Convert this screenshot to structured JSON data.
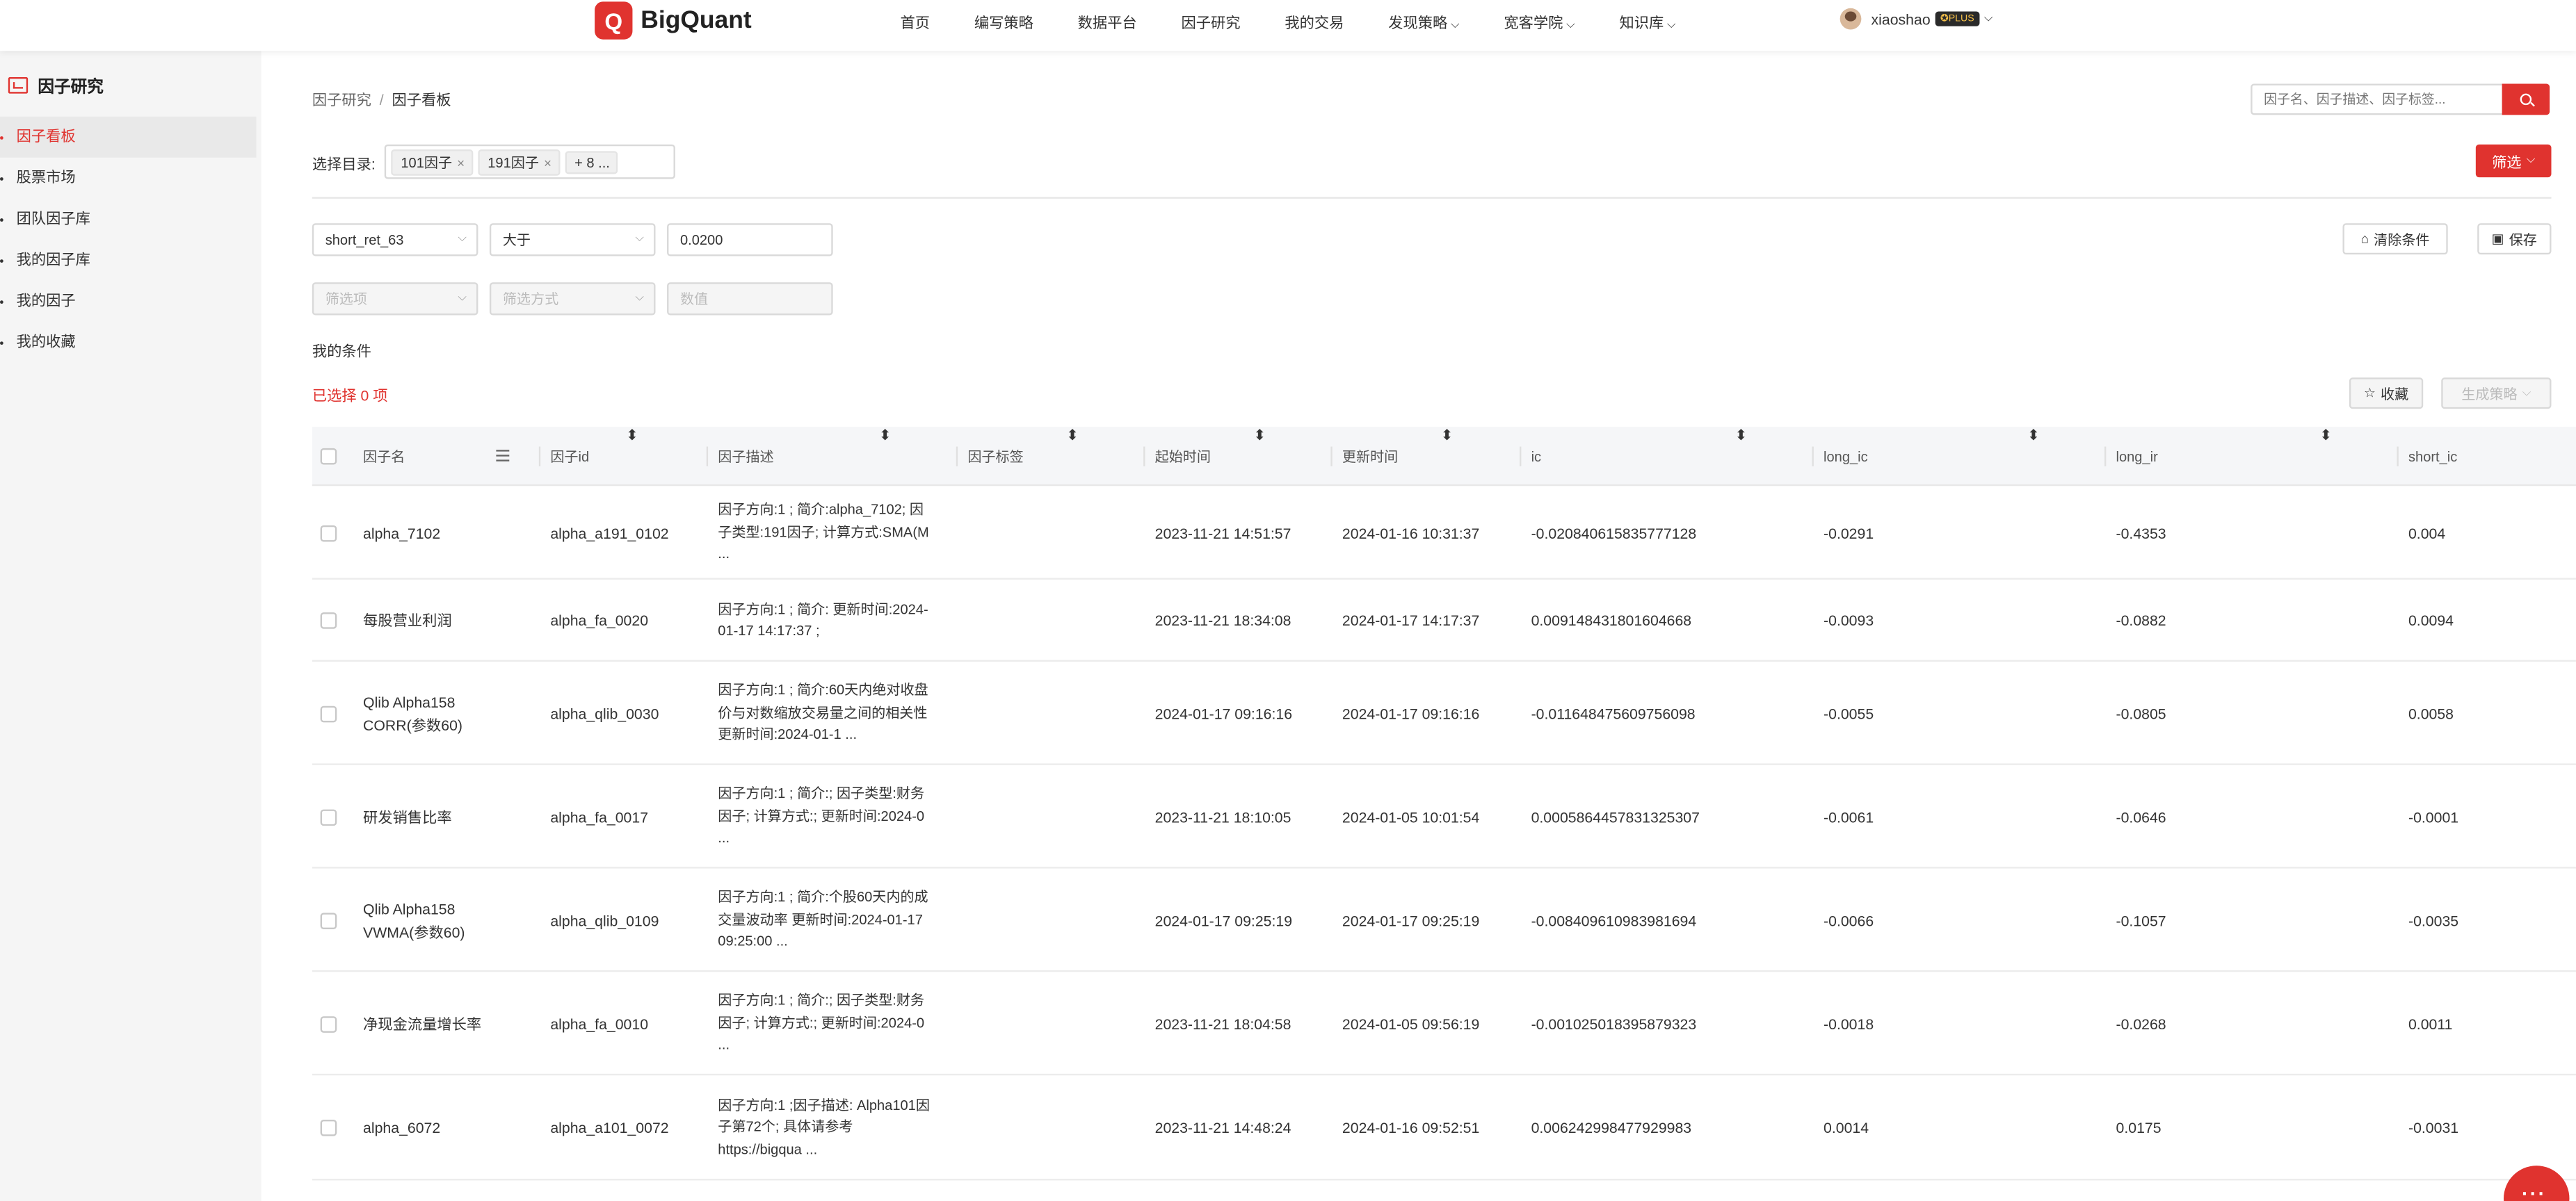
{
  "app": {
    "logo_letter": "Q",
    "logo_name": "BigQuant"
  },
  "nav": {
    "items": [
      {
        "label": "首页",
        "chev": false
      },
      {
        "label": "编写策略",
        "chev": false
      },
      {
        "label": "数据平台",
        "chev": false
      },
      {
        "label": "因子研究",
        "chev": false
      },
      {
        "label": "我的交易",
        "chev": false
      },
      {
        "label": "发现策略",
        "chev": true
      },
      {
        "label": "宽客学院",
        "chev": true
      },
      {
        "label": "知识库",
        "chev": true
      }
    ],
    "chev_glyph": "⌵"
  },
  "user": {
    "name": "xiaoshao",
    "badge": "✪PLUS",
    "chev": "⌵"
  },
  "sidebar": {
    "title": "因子研究",
    "items": [
      {
        "label": "因子看板",
        "active": true
      },
      {
        "label": "股票市场",
        "active": false
      },
      {
        "label": "团队因子库",
        "active": false
      },
      {
        "label": "我的因子库",
        "active": false
      },
      {
        "label": "我的因子",
        "active": false
      },
      {
        "label": "我的收藏",
        "active": false
      }
    ]
  },
  "breadcrumb": {
    "parent": "因子研究",
    "sep": "/",
    "current": "因子看板"
  },
  "search": {
    "placeholder": "因子名、因子描述、因子标签..."
  },
  "directory": {
    "label": "选择目录:",
    "tags": [
      "101因子",
      "191因子"
    ],
    "tag_close": "×",
    "more": "+ 8 ..."
  },
  "filter_button": {
    "label": "筛选",
    "chev": "⌵"
  },
  "condition_row": {
    "field": "short_ret_63",
    "operator": "大于",
    "value": "0.0200",
    "chev": "⌵"
  },
  "empty_row": {
    "field_placeholder": "筛选项",
    "operator_placeholder": "筛选方式",
    "value_placeholder": "数值"
  },
  "buttons": {
    "clear_icon": "⌂",
    "clear": "清除条件",
    "save_icon": "▣",
    "save": "保存",
    "favorite_icon": "☆",
    "favorite": "收藏",
    "generate": "生成策略",
    "generate_chev": "⌵"
  },
  "my_conditions": "我的条件",
  "selected_count": "已选择 0 项",
  "table": {
    "sort_glyph": "⬍",
    "columns": [
      "因子名",
      "因子id",
      "因子描述",
      "因子标签",
      "起始时间",
      "更新时间",
      "ic",
      "long_ic",
      "long_ir",
      "short_ic"
    ],
    "rows": [
      {
        "name": "alpha_7102",
        "id": "alpha_a191_0102",
        "desc": "因子方向:1 ; 简介:alpha_7102; 因子类型:191因子; 计算方式:SMA(M ...",
        "tags": "",
        "start": "2023-11-21 14:51:57",
        "updated": "2024-01-16 10:31:37",
        "ic": "-0.020840615835777128",
        "long_ic": "-0.0291",
        "long_ir": "-0.4353",
        "short_ic": "0.004"
      },
      {
        "name": "每股营业利润",
        "id": "alpha_fa_0020",
        "desc": "因子方向:1 ; 简介: 更新时间:2024-01-17 14:17:37 ;",
        "tags": "",
        "start": "2023-11-21 18:34:08",
        "updated": "2024-01-17 14:17:37",
        "ic": "0.009148431801604668",
        "long_ic": "-0.0093",
        "long_ir": "-0.0882",
        "short_ic": "0.0094"
      },
      {
        "name": "Qlib Alpha158 CORR(参数60)",
        "id": "alpha_qlib_0030",
        "desc": "因子方向:1 ; 简介:60天内绝对收盘价与对数缩放交易量之间的相关性 更新时间:2024-01-1 ...",
        "tags": "",
        "start": "2024-01-17 09:16:16",
        "updated": "2024-01-17 09:16:16",
        "ic": "-0.011648475609756098",
        "long_ic": "-0.0055",
        "long_ir": "-0.0805",
        "short_ic": "0.0058"
      },
      {
        "name": "研发销售比率",
        "id": "alpha_fa_0017",
        "desc": "因子方向:1 ; 简介:; 因子类型:财务因子; 计算方式:; 更新时间:2024-0 ...",
        "tags": "",
        "start": "2023-11-21 18:10:05",
        "updated": "2024-01-05 10:01:54",
        "ic": "0.0005864457831325307",
        "long_ic": "-0.0061",
        "long_ir": "-0.0646",
        "short_ic": "-0.0001"
      },
      {
        "name": "Qlib Alpha158 VWMA(参数60)",
        "id": "alpha_qlib_0109",
        "desc": "因子方向:1 ; 简介:个股60天内的成交量波动率 更新时间:2024-01-17 09:25:00 ...",
        "tags": "",
        "start": "2024-01-17 09:25:19",
        "updated": "2024-01-17 09:25:19",
        "ic": "-0.008409610983981694",
        "long_ic": "-0.0066",
        "long_ir": "-0.1057",
        "short_ic": "-0.0035"
      },
      {
        "name": "净现金流量增长率",
        "id": "alpha_fa_0010",
        "desc": "因子方向:1 ; 简介:; 因子类型:财务因子; 计算方式:; 更新时间:2024-0 ...",
        "tags": "",
        "start": "2023-11-21 18:04:58",
        "updated": "2024-01-05 09:56:19",
        "ic": "-0.001025018395879323",
        "long_ic": "-0.0018",
        "long_ir": "-0.0268",
        "short_ic": "0.0011"
      },
      {
        "name": "alpha_6072",
        "id": "alpha_a101_0072",
        "desc": "因子方向:1 ;因子描述: Alpha101因子第72个; 具体请参考https://bigqua ...",
        "tags": "",
        "start": "2023-11-21 14:48:24",
        "updated": "2024-01-16 09:52:51",
        "ic": "0.006242998477929983",
        "long_ic": "0.0014",
        "long_ir": "0.0175",
        "short_ic": "-0.0031"
      }
    ]
  },
  "colors": {
    "accent": "#e0332f",
    "sidebar_bg": "#f5f5f5",
    "header_bg": "#f5f6f8"
  }
}
